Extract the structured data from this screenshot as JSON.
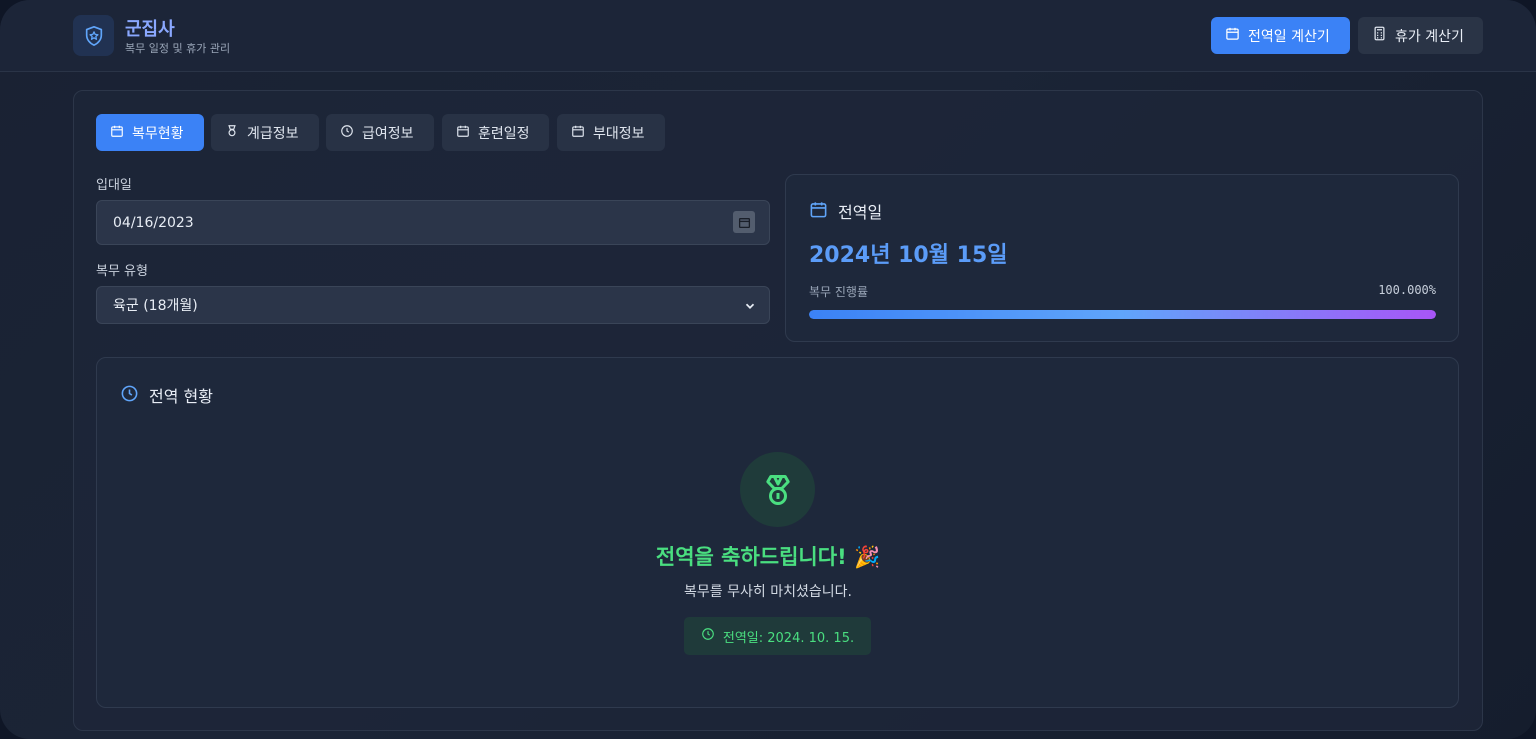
{
  "header": {
    "brand_title": "군집사",
    "brand_subtitle": "복무 일정 및 휴가 관리",
    "buttons": [
      {
        "label": "전역일 계산기",
        "icon": "calendar-icon",
        "active": true
      },
      {
        "label": "휴가 계산기",
        "icon": "calculator-icon",
        "active": false
      }
    ]
  },
  "tabs": [
    {
      "label": "복무현황",
      "icon": "calendar-icon",
      "active": true
    },
    {
      "label": "계급정보",
      "icon": "medal-icon",
      "active": false
    },
    {
      "label": "급여정보",
      "icon": "clock-icon",
      "active": false
    },
    {
      "label": "훈련일정",
      "icon": "calendar-icon",
      "active": false
    },
    {
      "label": "부대정보",
      "icon": "calendar-icon",
      "active": false
    }
  ],
  "form": {
    "enlist_label": "입대일",
    "enlist_value": "04/16/2023",
    "service_type_label": "복무 유형",
    "service_type_value": "육군 (18개월)"
  },
  "discharge": {
    "heading": "전역일",
    "date": "2024년 10월 15일",
    "progress_label": "복무 진행률",
    "progress_text": "100.000%",
    "progress": 1.0
  },
  "status": {
    "heading": "전역 현황",
    "congrats": "전역을 축하드립니다! 🎉",
    "message": "복무를 무사히 마치셨습니다.",
    "badge": "전역일: 2024. 10. 15."
  },
  "colors": {
    "accent": "#3b82f6",
    "success": "#4ade80",
    "date_highlight": "#5b9cf8"
  }
}
